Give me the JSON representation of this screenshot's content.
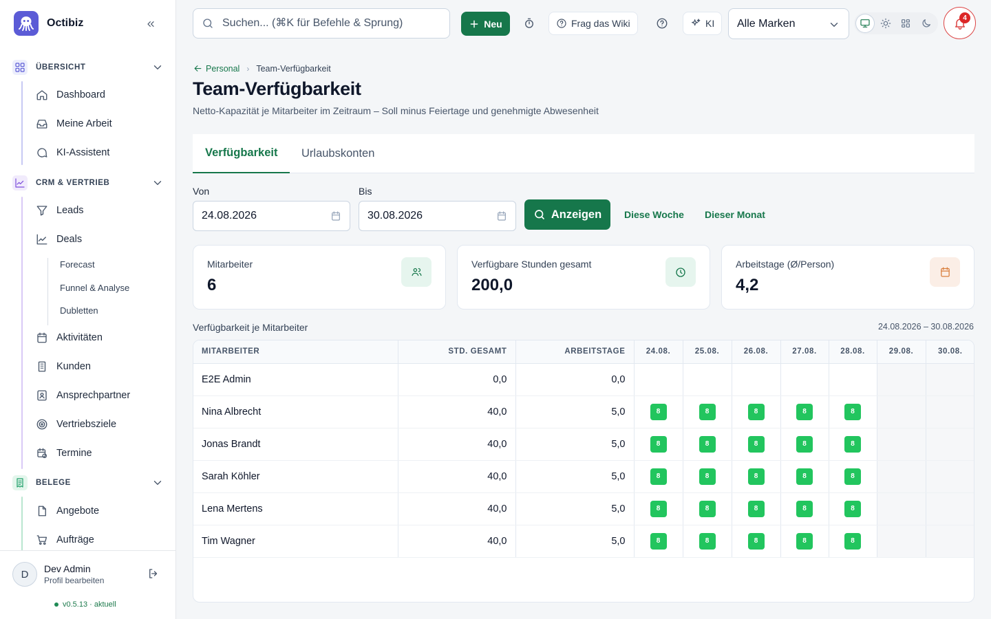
{
  "app": {
    "name": "Octibiz"
  },
  "sidebar": {
    "sections": [
      {
        "label": "ÜBERSICHT",
        "items": [
          {
            "label": "Dashboard"
          },
          {
            "label": "Meine Arbeit"
          },
          {
            "label": "KI-Assistent"
          }
        ]
      },
      {
        "label": "CRM & VERTRIEB",
        "items": [
          {
            "label": "Leads"
          },
          {
            "label": "Deals"
          },
          {
            "label": "Aktivitäten"
          },
          {
            "label": "Kunden"
          },
          {
            "label": "Ansprechpartner"
          },
          {
            "label": "Vertriebsziele"
          },
          {
            "label": "Termine"
          }
        ],
        "deals_sub": [
          {
            "label": "Forecast"
          },
          {
            "label": "Funnel & Analyse"
          },
          {
            "label": "Dubletten"
          }
        ]
      },
      {
        "label": "BELEGE",
        "items": [
          {
            "label": "Angebote"
          },
          {
            "label": "Aufträge"
          }
        ]
      }
    ],
    "user": {
      "initial": "D",
      "name": "Dev Admin",
      "profile": "Profil bearbeiten",
      "version": "v0.5.13 · aktuell"
    }
  },
  "topbar": {
    "search_placeholder": "Suchen... (⌘K für Befehle & Sprung)",
    "new_label": "Neu",
    "wiki_label": "Frag das Wiki",
    "ai_label": "KI",
    "brand_select": "Alle Marken",
    "notifications": "4"
  },
  "page": {
    "breadcrumb": {
      "parent": "Personal",
      "current": "Team-Verfügbarkeit"
    },
    "title": "Team-Verfügbarkeit",
    "subtitle": "Netto-Kapazität je Mitarbeiter im Zeitraum – Soll minus Feiertage und genehmigte Abwesenheit",
    "tabs": [
      {
        "label": "Verfügbarkeit",
        "active": true
      },
      {
        "label": "Urlaubskonten",
        "active": false
      }
    ],
    "filter": {
      "from_label": "Von",
      "from_value": "24.08.2026",
      "to_label": "Bis",
      "to_value": "30.08.2026",
      "show_label": "Anzeigen",
      "this_week": "Diese Woche",
      "this_month": "Dieser Monat"
    },
    "stats": [
      {
        "label": "Mitarbeiter",
        "value": "6",
        "icon": "users-icon"
      },
      {
        "label": "Verfügbare Stunden gesamt",
        "value": "200,0",
        "icon": "clock-icon"
      },
      {
        "label": "Arbeitstage (Ø/Person)",
        "value": "4,2",
        "icon": "calendar-icon"
      }
    ],
    "table": {
      "title": "Verfügbarkeit je Mitarbeiter",
      "range": "24.08.2026 – 30.08.2026",
      "headers": {
        "name": "MITARBEITER",
        "hours": "STD. GESAMT",
        "days": "ARBEITSTAGE"
      },
      "dates": [
        "24.08.",
        "25.08.",
        "26.08.",
        "27.08.",
        "28.08.",
        "29.08.",
        "30.08."
      ],
      "rows": [
        {
          "name": "E2E Admin",
          "hours": "0,0",
          "days": "0,0",
          "cells": [
            "",
            "",
            "",
            "",
            "",
            "",
            ""
          ]
        },
        {
          "name": "Nina Albrecht",
          "hours": "40,0",
          "days": "5,0",
          "cells": [
            "8",
            "8",
            "8",
            "8",
            "8",
            "",
            ""
          ]
        },
        {
          "name": "Jonas Brandt",
          "hours": "40,0",
          "days": "5,0",
          "cells": [
            "8",
            "8",
            "8",
            "8",
            "8",
            "",
            ""
          ]
        },
        {
          "name": "Sarah Köhler",
          "hours": "40,0",
          "days": "5,0",
          "cells": [
            "8",
            "8",
            "8",
            "8",
            "8",
            "",
            ""
          ]
        },
        {
          "name": "Lena Mertens",
          "hours": "40,0",
          "days": "5,0",
          "cells": [
            "8",
            "8",
            "8",
            "8",
            "8",
            "",
            ""
          ]
        },
        {
          "name": "Tim Wagner",
          "hours": "40,0",
          "days": "5,0",
          "cells": [
            "8",
            "8",
            "8",
            "8",
            "8",
            "",
            ""
          ]
        }
      ]
    }
  },
  "colors": {
    "accent": "#16774b",
    "available": "#22c55e",
    "notification": "#dc2626",
    "sidebar_overview": "#5b5bd6",
    "sidebar_crm": "#7c4ddb",
    "sidebar_belege": "#22a06b"
  }
}
